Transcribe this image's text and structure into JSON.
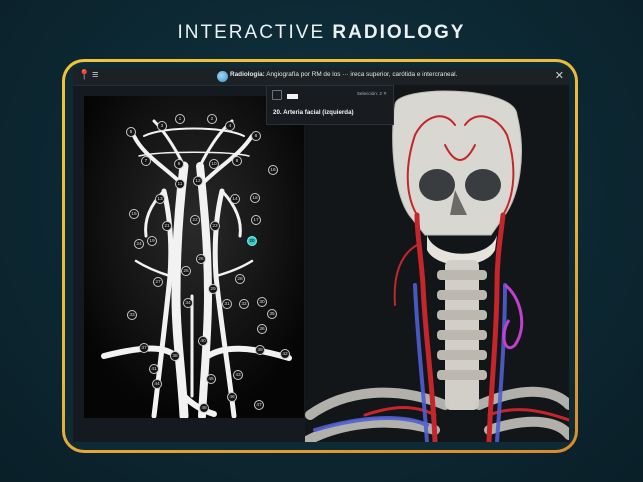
{
  "headline": {
    "prefix": "INTERACTIVE",
    "emphasis": "RADIOLOGY"
  },
  "window": {
    "module": "Radiología:",
    "subtitle": "Angiografía por RM de los ··· ireca superior, carótida e intercraneal.",
    "close_glyph": "✕",
    "pin_glyph": "📍",
    "menu_glyph": "≡"
  },
  "popup": {
    "selected_label": "Selección: 2 ✕",
    "structure": "20. Arteria facial (izquierda)"
  },
  "callouts": [
    "1",
    "2",
    "3",
    "4",
    "5",
    "6",
    "7",
    "8",
    "9",
    "10",
    "11",
    "12",
    "13",
    "14",
    "15",
    "16",
    "17",
    "18",
    "19",
    "20",
    "21",
    "22",
    "23",
    "24",
    "25",
    "26",
    "27",
    "28",
    "29",
    "30",
    "31",
    "32",
    "33",
    "34",
    "35",
    "36",
    "37",
    "38",
    "39",
    "40",
    "41",
    "42",
    "43",
    "44",
    "45",
    "46",
    "47",
    "48"
  ],
  "active_callout": "20",
  "colors": {
    "frame_top": "#f2c23a",
    "frame_bottom": "#d98a2c",
    "active": "#36c7c9",
    "artery": "#c4262b",
    "vein": "#4f5fd1"
  }
}
